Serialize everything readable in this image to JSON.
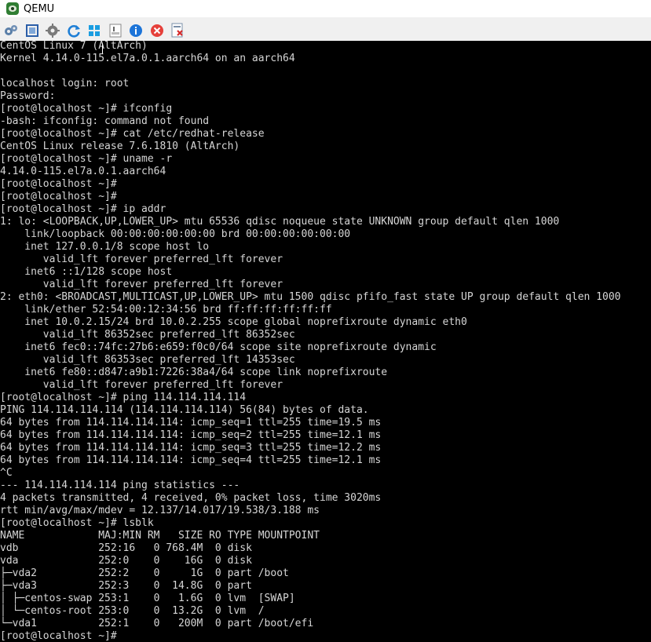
{
  "window": {
    "title": "QEMU"
  },
  "toolbar": {
    "buttons": [
      {
        "name": "settings-gears-icon"
      },
      {
        "name": "fullscreen-icon"
      },
      {
        "name": "gear-icon"
      },
      {
        "name": "refresh-icon"
      },
      {
        "name": "windows-logo-icon"
      },
      {
        "name": "document-icon"
      },
      {
        "name": "info-icon"
      },
      {
        "name": "close-circle-icon"
      },
      {
        "name": "shutdown-icon"
      }
    ]
  },
  "terminal": {
    "lines": [
      "CentOS Linux 7 (AltArch)",
      "Kernel 4.14.0-115.el7a.0.1.aarch64 on an aarch64",
      "",
      "localhost login: root",
      "Password:",
      "[root@localhost ~]# ifconfig",
      "-bash: ifconfig: command not found",
      "[root@localhost ~]# cat /etc/redhat-release",
      "CentOS Linux release 7.6.1810 (AltArch)",
      "[root@localhost ~]# uname -r",
      "4.14.0-115.el7a.0.1.aarch64",
      "[root@localhost ~]#",
      "[root@localhost ~]#",
      "[root@localhost ~]# ip addr",
      "1: lo: <LOOPBACK,UP,LOWER_UP> mtu 65536 qdisc noqueue state UNKNOWN group default qlen 1000",
      "    link/loopback 00:00:00:00:00:00 brd 00:00:00:00:00:00",
      "    inet 127.0.0.1/8 scope host lo",
      "       valid_lft forever preferred_lft forever",
      "    inet6 ::1/128 scope host",
      "       valid_lft forever preferred_lft forever",
      "2: eth0: <BROADCAST,MULTICAST,UP,LOWER_UP> mtu 1500 qdisc pfifo_fast state UP group default qlen 1000",
      "    link/ether 52:54:00:12:34:56 brd ff:ff:ff:ff:ff:ff",
      "    inet 10.0.2.15/24 brd 10.0.2.255 scope global noprefixroute dynamic eth0",
      "       valid_lft 86352sec preferred_lft 86352sec",
      "    inet6 fec0::74fc:27b6:e659:f0c0/64 scope site noprefixroute dynamic",
      "       valid_lft 86353sec preferred_lft 14353sec",
      "    inet6 fe80::d847:a9b1:7226:38a4/64 scope link noprefixroute",
      "       valid_lft forever preferred_lft forever",
      "[root@localhost ~]# ping 114.114.114.114",
      "PING 114.114.114.114 (114.114.114.114) 56(84) bytes of data.",
      "64 bytes from 114.114.114.114: icmp_seq=1 ttl=255 time=19.5 ms",
      "64 bytes from 114.114.114.114: icmp_seq=2 ttl=255 time=12.1 ms",
      "64 bytes from 114.114.114.114: icmp_seq=3 ttl=255 time=12.2 ms",
      "64 bytes from 114.114.114.114: icmp_seq=4 ttl=255 time=12.1 ms",
      "^C",
      "--- 114.114.114.114 ping statistics ---",
      "4 packets transmitted, 4 received, 0% packet loss, time 3020ms",
      "rtt min/avg/max/mdev = 12.137/14.017/19.538/3.188 ms",
      "[root@localhost ~]# lsblk",
      "NAME            MAJ:MIN RM   SIZE RO TYPE MOUNTPOINT",
      "vdb             252:16   0 768.4M  0 disk",
      "vda             252:0    0    16G  0 disk",
      "├─vda2          252:2    0     1G  0 part /boot",
      "├─vda3          252:3    0  14.8G  0 part",
      "│ ├─centos-swap 253:1    0   1.6G  0 lvm  [SWAP]",
      "│ └─centos-root 253:0    0  13.2G  0 lvm  /",
      "└─vda1          252:1    0   200M  0 part /boot/efi",
      "[root@localhost ~]#"
    ]
  }
}
